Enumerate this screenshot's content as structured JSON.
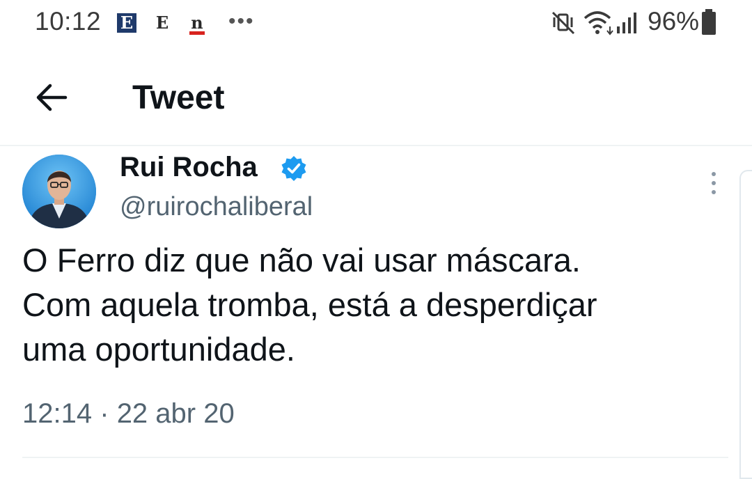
{
  "status_bar": {
    "time": "10:12",
    "notifications": [
      "E",
      "E",
      "n"
    ],
    "more_notifications": "•••",
    "icons": [
      "mute-vibrate-icon",
      "wifi-icon",
      "signal-icon",
      "battery-icon"
    ],
    "battery_percent": "96%"
  },
  "header": {
    "back_icon": "arrow-left-icon",
    "title": "Tweet"
  },
  "tweet": {
    "author": {
      "name": "Rui Rocha",
      "handle": "@ruirochaliberal",
      "verified": true
    },
    "text_lines": [
      "O Ferro diz que não vai usar máscara.",
      "Com aquela tromba, está a desperdiçar",
      "uma oportunidade."
    ],
    "time": "12:14",
    "separator": "·",
    "date": "22 abr 20"
  },
  "colors": {
    "primary_text": "#0f1419",
    "secondary_text": "#536471",
    "verified_blue": "#1d9bf0",
    "divider": "#eff3f4"
  }
}
